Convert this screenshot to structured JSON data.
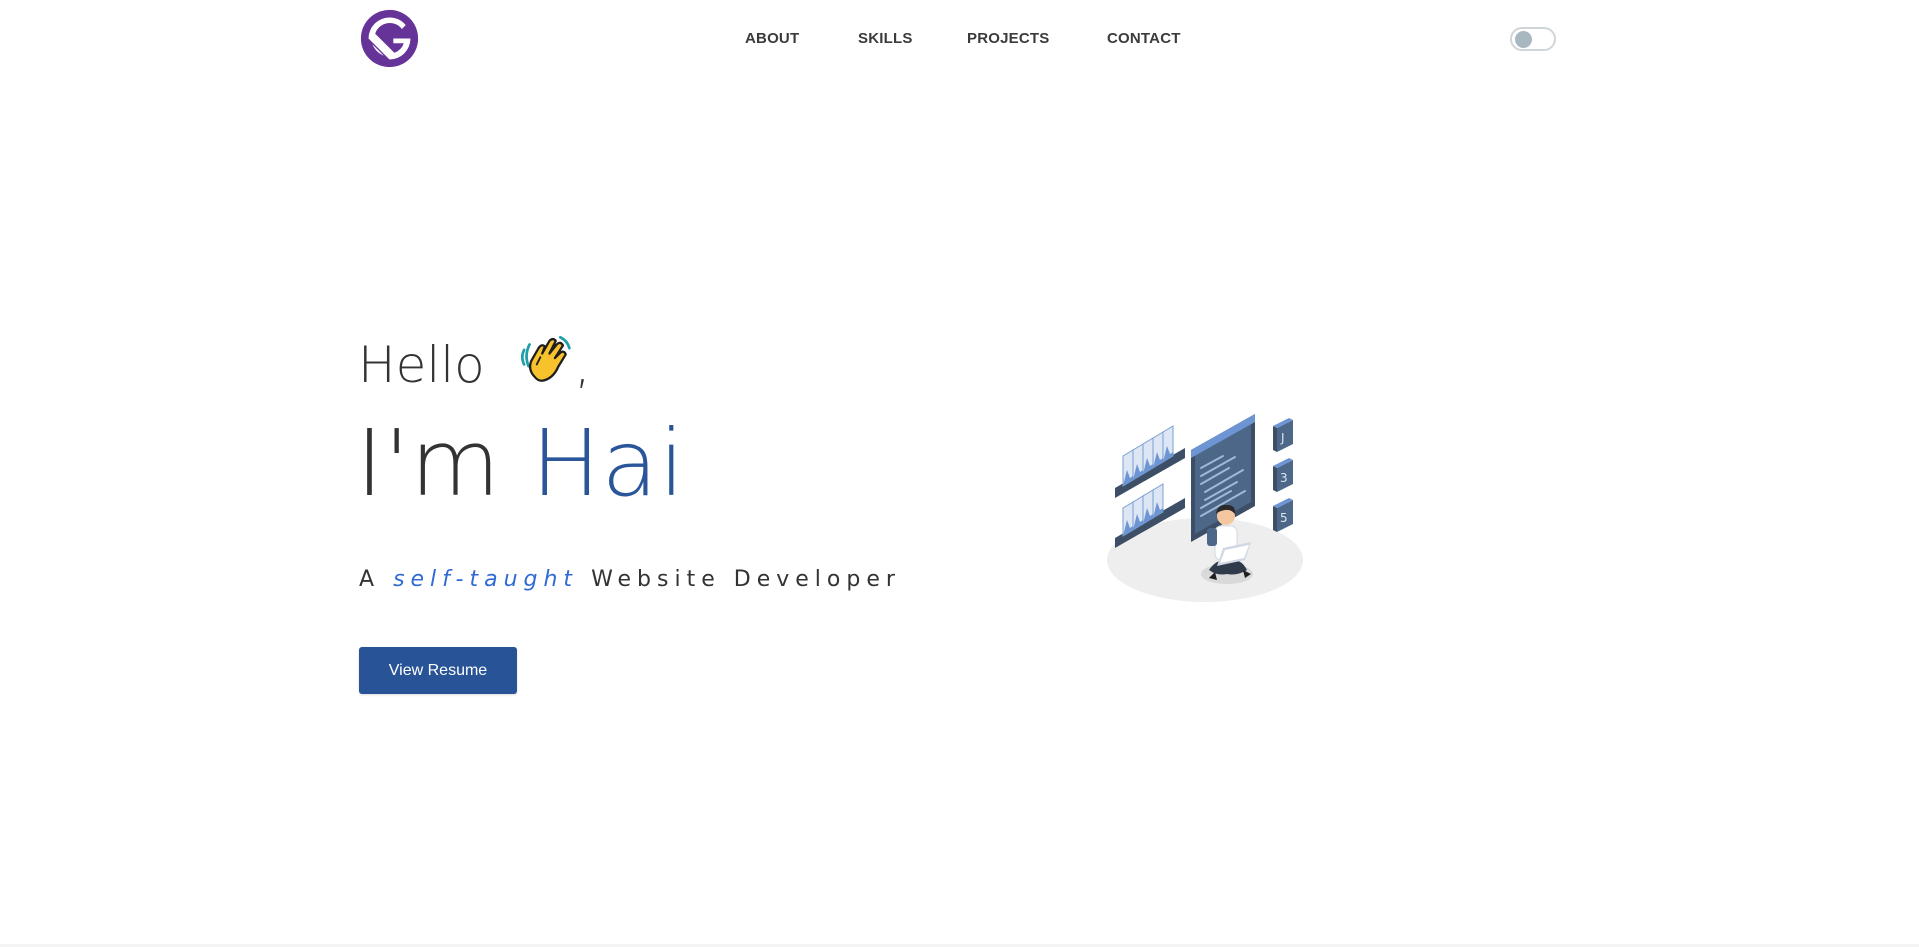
{
  "header": {
    "logo_icon": "gatsby-logo-icon",
    "brand_color": "#663399",
    "nav": {
      "about": "ABOUT",
      "skills": "SKILLS",
      "projects": "PROJECTS",
      "contact": "CONTACT"
    },
    "theme_toggle": {
      "state": "off"
    }
  },
  "hero": {
    "greeting": "Hello",
    "greeting_emoji": "waving-hand-icon",
    "greeting_punct": ",",
    "intro": "I'm",
    "name": "Hai",
    "name_color": "#2a5599",
    "tagline_prefix": "A",
    "tagline_emphasis": "self-taught",
    "tagline_suffix": "Website Developer",
    "tagline_emphasis_color": "#2f6bd6",
    "resume_button": "View Resume",
    "button_color": "#285497",
    "illustration_icon": "developer-with-laptop-illustration"
  }
}
